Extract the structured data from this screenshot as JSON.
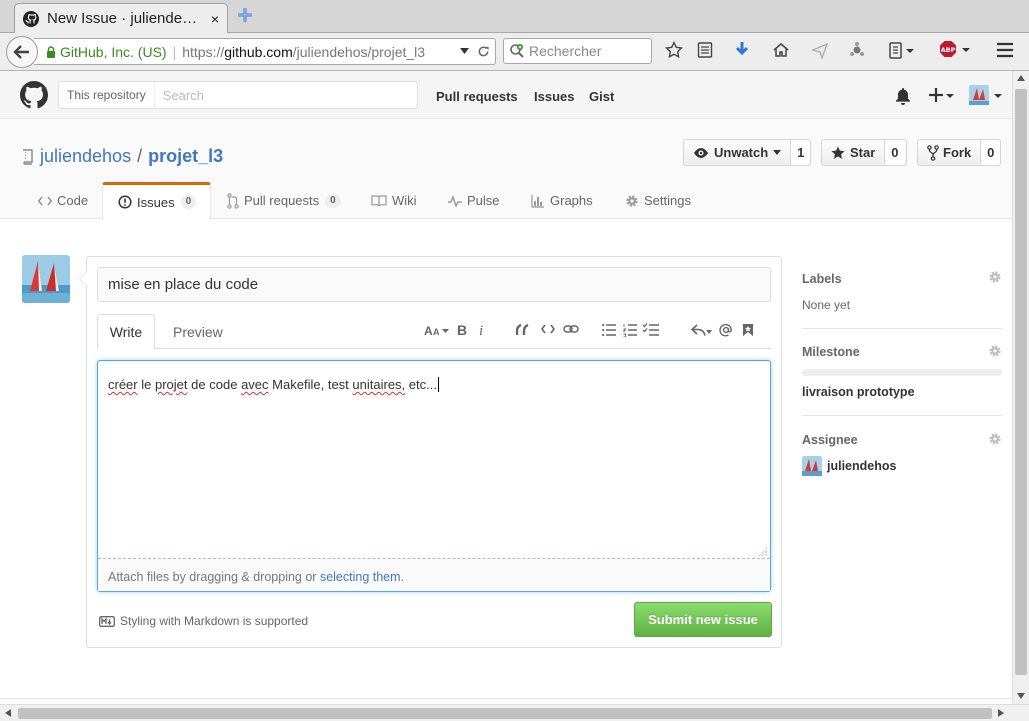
{
  "browser": {
    "tab_title": "New Issue · juliende…",
    "tab_close": "×",
    "url_org": "GitHub, Inc. (US)",
    "url_prefix": "https://",
    "url_host": "github.com",
    "url_path": "/juliendehos/projet_l3",
    "search_placeholder": "Rechercher",
    "adblock_label": "ABP"
  },
  "header": {
    "scope_label": "This repository",
    "search_placeholder": "Search",
    "nav": [
      "Pull requests",
      "Issues",
      "Gist"
    ]
  },
  "repo": {
    "owner": "juliendehos",
    "slash": "/",
    "name": "projet_l3",
    "watch_label": "Unwatch",
    "watch_count": "1",
    "star_label": "Star",
    "star_count": "0",
    "fork_label": "Fork",
    "fork_count": "0",
    "tabs": {
      "code": "Code",
      "issues": "Issues",
      "issues_count": "0",
      "pulls": "Pull requests",
      "pulls_count": "0",
      "wiki": "Wiki",
      "pulse": "Pulse",
      "graphs": "Graphs",
      "settings": "Settings"
    }
  },
  "composer": {
    "title_value": "mise en place du code",
    "write_tab": "Write",
    "preview_tab": "Preview",
    "body_words": [
      "créer",
      "le",
      "projet",
      "de",
      "code",
      "avec",
      "Makefile,",
      "test",
      "unitaires,",
      "etc..."
    ],
    "drop_text": "Attach files by dragging & dropping or",
    "drop_link": "selecting them",
    "drop_end": ".",
    "markdown_note": "Styling with Markdown is supported",
    "submit_label": "Submit new issue"
  },
  "sidebar": {
    "labels_heading": "Labels",
    "labels_value": "None yet",
    "milestone_heading": "Milestone",
    "milestone_value": "livraison prototype",
    "milestone_progress": 0,
    "assignee_heading": "Assignee",
    "assignee_value": "juliendehos"
  },
  "colors": {
    "link": "#4078c0",
    "issues_tab_accent": "#d26911",
    "submit_green": "#60b044",
    "focus_blue": "#51a7e8"
  }
}
